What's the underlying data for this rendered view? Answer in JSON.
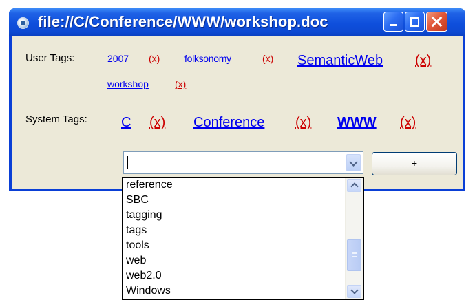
{
  "window": {
    "title": "file://C/Conference/WWW/workshop.doc"
  },
  "user_tags": {
    "label": "User Tags:",
    "remove_label": "(x)",
    "items": [
      "2007",
      "folksonomy",
      "SemanticWeb",
      "workshop"
    ]
  },
  "system_tags": {
    "label": "System Tags:",
    "remove_label": "(x)",
    "items": [
      "C",
      "Conference",
      "WWW"
    ]
  },
  "tag_input": {
    "value": ""
  },
  "add_button": {
    "label": "+"
  },
  "dropdown": {
    "options": [
      "reference",
      "SBC",
      "tagging",
      "tags",
      "tools",
      "web",
      "web2.0",
      "Windows"
    ]
  },
  "colors": {
    "titlebar": "#0d49d2",
    "client_bg": "#ece9d8",
    "tag_link": "#0000ee",
    "remove_link": "#cc0000"
  }
}
